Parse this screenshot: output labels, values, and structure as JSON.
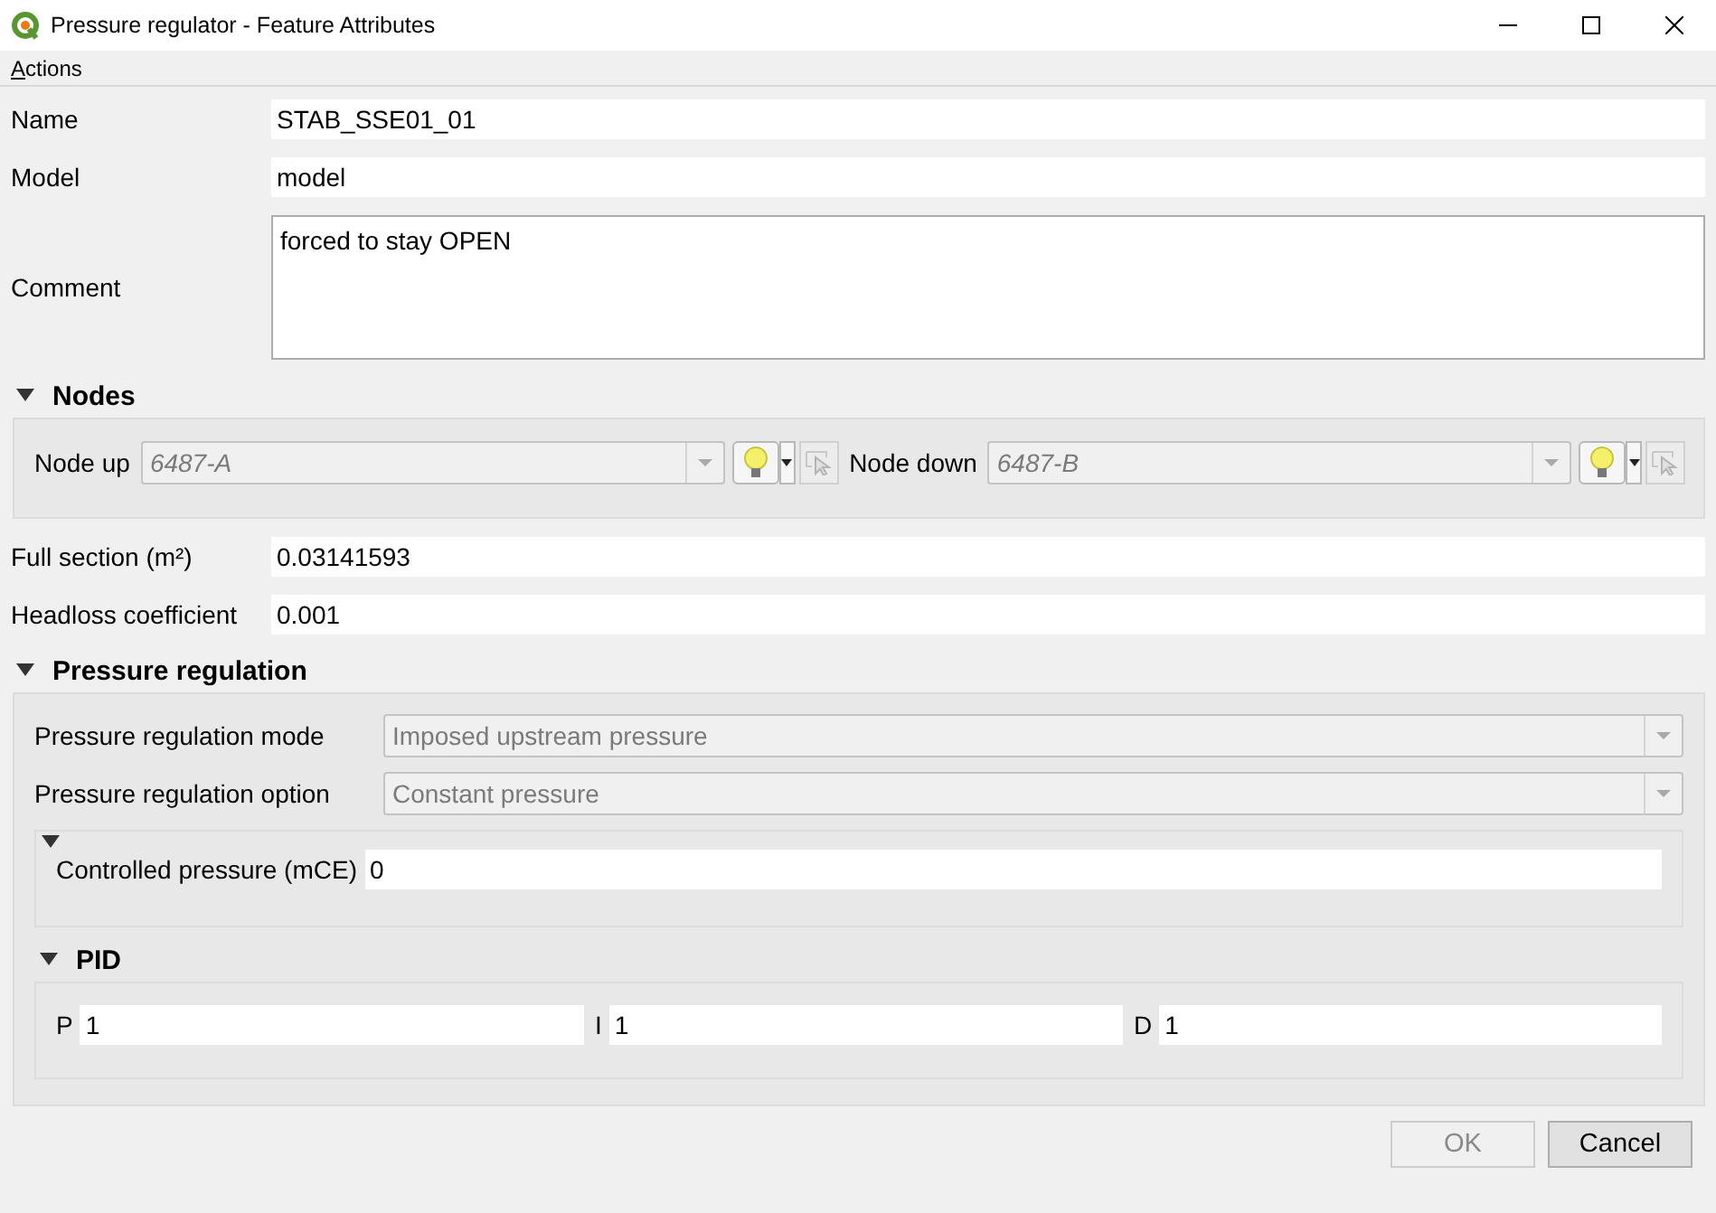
{
  "window": {
    "title": "Pressure regulator - Feature Attributes"
  },
  "menu": [
    {
      "label": "Actions"
    }
  ],
  "fields": [
    {
      "label": "Name",
      "value": "STAB_SSE01_01",
      "kind": "line"
    },
    {
      "label": "Model",
      "value": "model",
      "kind": "line"
    },
    {
      "label": "Comment",
      "value": "forced to stay OPEN",
      "kind": "multiline"
    }
  ],
  "nodes": {
    "title": "Nodes",
    "expanded": true,
    "relations": [
      {
        "label": "Node up",
        "value": "6487-A",
        "disabled": true
      },
      {
        "label": "Node down",
        "value": "6487-B",
        "disabled": true
      }
    ]
  },
  "fields_2": [
    {
      "label": "Full section (m²)",
      "value": "0.03141593",
      "kind": "line"
    },
    {
      "label": "Headloss coefficient",
      "value": "0.001",
      "kind": "line"
    }
  ],
  "pressure_regulation": {
    "title": "Pressure regulation",
    "expanded": true,
    "combos": [
      {
        "label": "Pressure regulation mode",
        "value": "Imposed upstream pressure",
        "disabled": true
      },
      {
        "label": "Pressure regulation option",
        "value": "Constant pressure",
        "disabled": true
      }
    ],
    "subgroup": {
      "expanded": true,
      "fields": [
        {
          "label": "Controlled pressure (mCE)",
          "value": "0"
        }
      ]
    },
    "pid": {
      "title": "PID",
      "expanded": true,
      "fields": [
        {
          "label": "P",
          "value": "1"
        },
        {
          "label": "I",
          "value": "1"
        },
        {
          "label": "D",
          "value": "1"
        }
      ]
    }
  },
  "buttons": [
    {
      "label": "OK",
      "disabled": true
    },
    {
      "label": "Cancel",
      "disabled": false
    }
  ]
}
